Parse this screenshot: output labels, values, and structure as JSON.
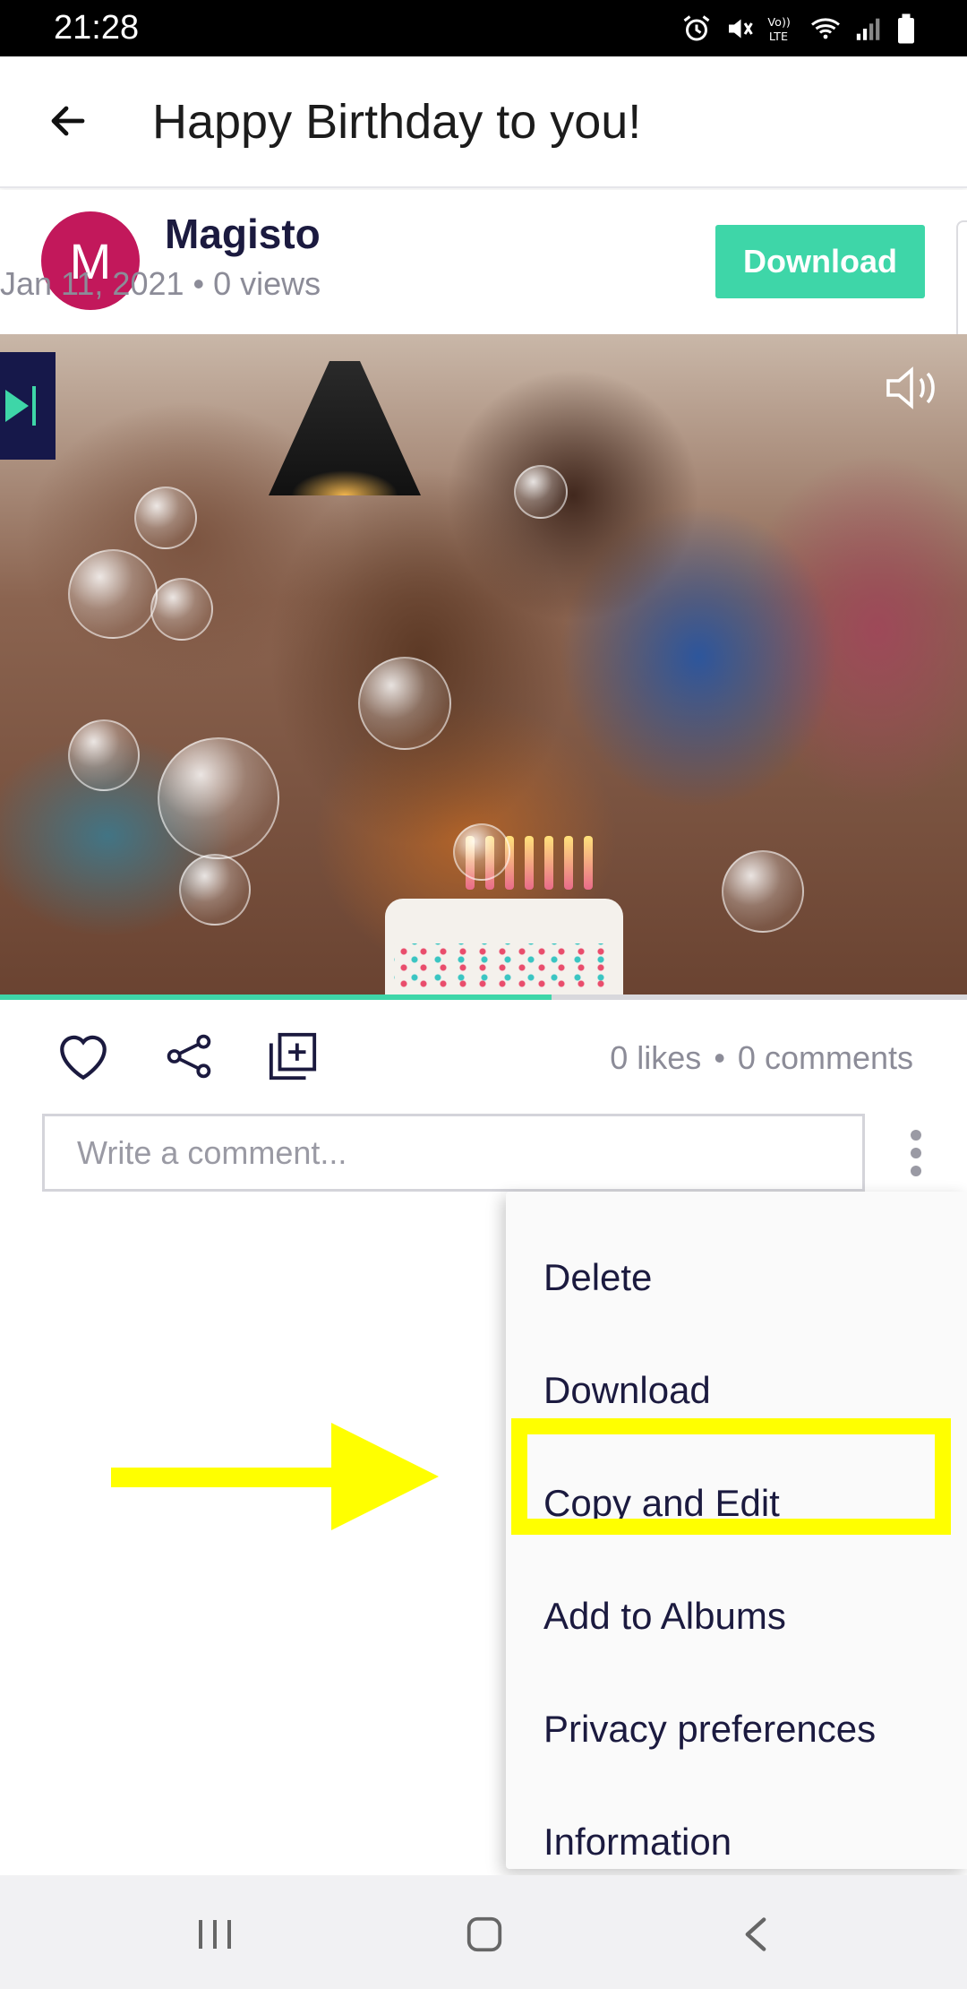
{
  "status_bar": {
    "time": "21:28",
    "icons": [
      "alarm-icon",
      "mute-icon",
      "volte-icon",
      "wifi-icon",
      "signal-icon",
      "battery-icon"
    ]
  },
  "app_bar": {
    "title": "Happy Birthday to you!",
    "back_icon": "arrow-left-icon"
  },
  "author": {
    "avatar_letter": "M",
    "avatar_color": "#c2185b",
    "name": "Magisto",
    "meta": "Jan 11, 2021 • 0 views",
    "download_label": "Download",
    "accent_color": "#3ed6a8"
  },
  "video": {
    "progress_fraction": 0.57,
    "mute_icon": "speaker-mute-icon"
  },
  "actions": {
    "likes": "0 likes",
    "separator": "•",
    "comments": "0 comments"
  },
  "comment": {
    "placeholder": "Write a comment..."
  },
  "menu": {
    "items": [
      {
        "label": "Delete"
      },
      {
        "label": "Download"
      },
      {
        "label": "Copy and Edit",
        "highlighted": true
      },
      {
        "label": "Add to Albums"
      },
      {
        "label": "Privacy preferences"
      },
      {
        "label": "Information"
      }
    ]
  },
  "annotation": {
    "color": "#ffff00"
  },
  "nav_bar": {
    "icons": [
      "recent-apps-icon",
      "home-icon",
      "back-icon"
    ]
  }
}
